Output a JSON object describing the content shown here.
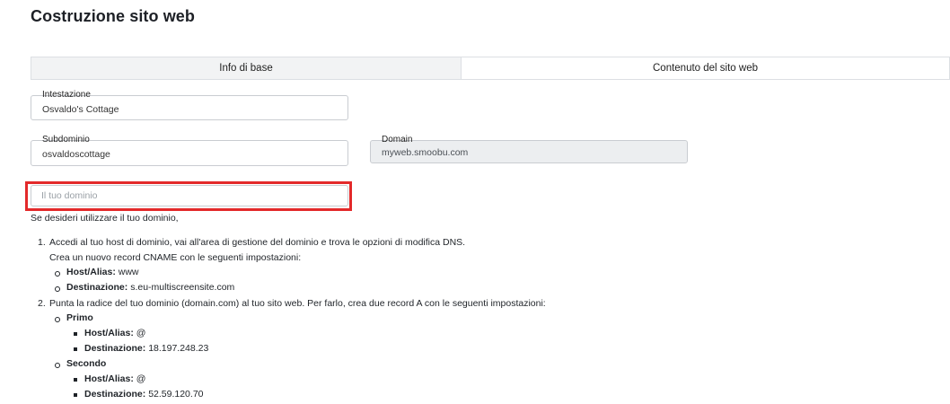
{
  "page": {
    "title": "Costruzione sito web"
  },
  "tabs": [
    {
      "label": "Info di base"
    },
    {
      "label": "Contenuto del sito web"
    }
  ],
  "form": {
    "heading": {
      "label": "Intestazione",
      "value": "Osvaldo's Cottage"
    },
    "subdomain": {
      "label": "Subdominio",
      "value": "osvaldoscottage"
    },
    "domain": {
      "label": "Domain",
      "value": "myweb.smoobu.com"
    },
    "custom_domain": {
      "placeholder": "Il tuo dominio",
      "value": ""
    }
  },
  "instructions": {
    "intro": "Se desideri utilizzare il tuo dominio,",
    "step1": {
      "number": "1.",
      "text": "Accedi al tuo host di dominio, vai all'area di gestione del dominio e trova le opzioni di modifica DNS.",
      "subtext": "Crea un nuovo record CNAME con le seguenti impostazioni:",
      "host_label": "Host/Alias:",
      "host_value": "www",
      "dest_label": "Destinazione:",
      "dest_value": "s.eu-multiscreensite.com"
    },
    "step2": {
      "number": "2.",
      "text": "Punta la radice del tuo dominio (domain.com) al tuo sito web. Per farlo, crea due record A con le seguenti impostazioni:",
      "first": {
        "label": "Primo",
        "host_label": "Host/Alias:",
        "host_value": "@",
        "dest_label": "Destinazione:",
        "dest_value": "18.197.248.23"
      },
      "second": {
        "label": "Secondo",
        "host_label": "Host/Alias:",
        "host_value": "@",
        "dest_label": "Destinazione:",
        "dest_value": "52.59.120.70"
      }
    }
  },
  "colors": {
    "highlight": "#e3292a",
    "tab_active_bg": "#f2f3f4",
    "disabled_field_bg": "#eceef0"
  }
}
